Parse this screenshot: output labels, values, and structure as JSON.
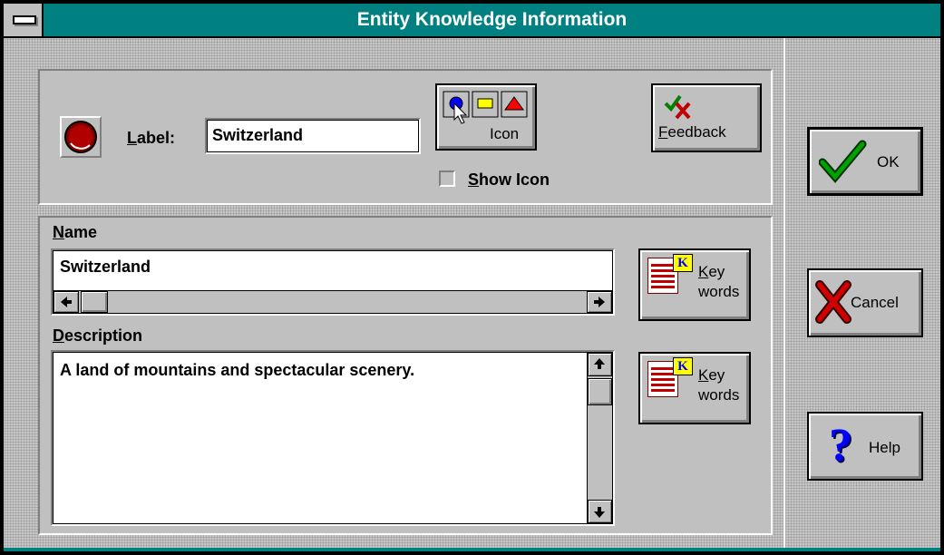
{
  "window": {
    "title": "Entity Knowledge Information"
  },
  "top_panel": {
    "label_prefix": "L",
    "label_rest": "abel:",
    "label_value": "Switzerland",
    "icon_button_label": "Icon",
    "feedback_prefix": "F",
    "feedback_rest": "eedback",
    "show_icon_prefix": "S",
    "show_icon_rest": "how Icon",
    "show_icon_checked": false
  },
  "name_section": {
    "heading_prefix": "N",
    "heading_rest": "ame",
    "value": "Switzerland",
    "keywords_line1_prefix": "K",
    "keywords_line1_rest": "ey",
    "keywords_line2": "words"
  },
  "description_section": {
    "heading_prefix": "D",
    "heading_rest": "escription",
    "value": "A land of mountains and spectacular scenery.",
    "keywords_line1_prefix": "K",
    "keywords_line1_rest": "ey",
    "keywords_line2": "words"
  },
  "side_buttons": {
    "ok": "OK",
    "cancel": "Cancel",
    "help": "Help"
  },
  "icons": {
    "entity": "red-ball-icon",
    "icon_picker": "shape-palette-icon",
    "feedback": "check-cross-icon",
    "keywords": "keyword-document-icon",
    "ok": "green-checkmark-icon",
    "cancel": "red-x-icon",
    "help": "question-mark-icon"
  },
  "colors": {
    "title_bar": "#008080",
    "face": "#c0c0c0",
    "ok_check": "#008000",
    "cancel_x": "#c00000",
    "help_q": "#0000c0"
  }
}
